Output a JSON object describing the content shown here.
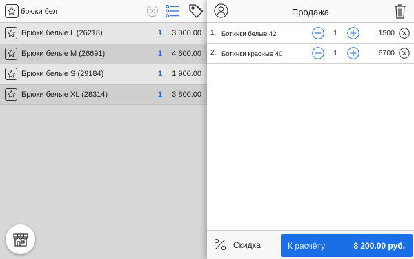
{
  "search": {
    "value": "брюки бел"
  },
  "results": [
    {
      "name": "Брюки белые L (26218)",
      "qty": "1",
      "price": "3 000.00"
    },
    {
      "name": "Брюки белые M (26691)",
      "qty": "1",
      "price": "4 600.00"
    },
    {
      "name": "Брюки белые S (29184)",
      "qty": "1",
      "price": "1 900.00"
    },
    {
      "name": "Брюки белые XL (28314)",
      "qty": "1",
      "price": "3 800.00"
    }
  ],
  "sale": {
    "title": "Продажа",
    "items": [
      {
        "num": "1.",
        "name": "Ботинки белые 42",
        "qty": "1",
        "price": "1500"
      },
      {
        "num": "2.",
        "name": "Ботинки красные 40",
        "qty": "1",
        "price": "6700"
      }
    ]
  },
  "footer": {
    "discount_label": "Скидка",
    "pay_label": "К расчёту",
    "total": "8 200.00 руб."
  },
  "colors": {
    "accent": "#1a6ee8"
  },
  "icons": {
    "favorite": "star-icon",
    "clear": "clear-icon",
    "list": "list-icon",
    "tag": "tag-icon",
    "store": "store-icon",
    "user": "user-icon",
    "trash": "trash-icon",
    "minus": "minus-icon",
    "plus": "plus-icon",
    "remove": "remove-icon",
    "percent": "percent-icon"
  }
}
